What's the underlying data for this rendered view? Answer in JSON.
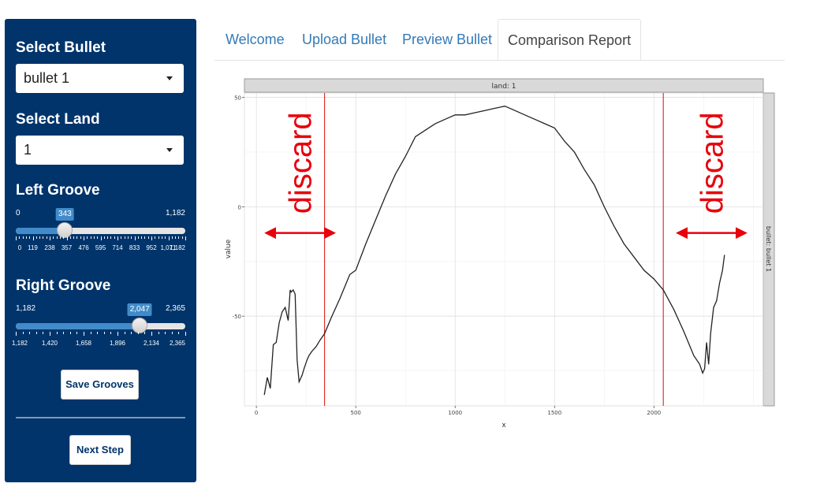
{
  "sidebar": {
    "select_bullet": {
      "label": "Select Bullet",
      "value": "bullet 1"
    },
    "select_land": {
      "label": "Select Land",
      "value": "1"
    },
    "left_groove": {
      "label": "Left Groove",
      "min_label": "0",
      "max_label": "1,182",
      "value_label": "343",
      "min": 0,
      "max": 1182,
      "value": 343,
      "ticks": [
        "0",
        "119",
        "238",
        "357",
        "476",
        "595",
        "714",
        "833",
        "952",
        "1,071",
        "1,182"
      ]
    },
    "right_groove": {
      "label": "Right Groove",
      "min_label": "1,182",
      "max_label": "2,365",
      "value_label": "2,047",
      "min": 1182,
      "max": 2365,
      "value": 2047,
      "ticks": [
        "1,182",
        "1,420",
        "1,658",
        "1,896",
        "2,134",
        "2,365"
      ]
    },
    "save_button": "Save Grooves",
    "next_button": "Next Step"
  },
  "tabs": [
    {
      "label": "Welcome",
      "active": false
    },
    {
      "label": "Upload Bullet",
      "active": false
    },
    {
      "label": "Preview Bullet",
      "active": false
    },
    {
      "label": "Comparison Report",
      "active": true
    }
  ],
  "chart_data": {
    "type": "line",
    "facet_top": "land: 1",
    "facet_right": "bullet: bullet 1",
    "xlabel": "x",
    "ylabel": "value",
    "xlim": [
      -60,
      2550
    ],
    "ylim": [
      -91,
      52
    ],
    "xticks": [
      0,
      500,
      1000,
      1500,
      2000
    ],
    "yticks": [
      -50,
      0,
      50
    ],
    "grid": true,
    "vlines": [
      343,
      2047
    ],
    "vline_color": "#e0201c",
    "annotation_color": "#e8000b",
    "annotations": [
      {
        "text": "discard",
        "x": 220,
        "y": 5
      },
      {
        "text": "discard",
        "x": 2290,
        "y": 5
      }
    ],
    "series": [
      {
        "x": [
          40,
          55,
          70,
          85,
          100,
          115,
          130,
          145,
          160,
          170,
          175,
          185,
          195,
          205,
          215,
          220,
          230,
          240,
          255,
          265,
          280,
          300,
          320,
          343,
          380,
          420,
          470,
          500,
          550,
          600,
          650,
          700,
          750,
          800,
          850,
          900,
          950,
          1000,
          1050,
          1100,
          1150,
          1200,
          1250,
          1300,
          1350,
          1400,
          1450,
          1500,
          1550,
          1600,
          1650,
          1700,
          1750,
          1800,
          1850,
          1900,
          1950,
          2000,
          2047,
          2100,
          2150,
          2200,
          2230,
          2245,
          2255,
          2265,
          2275,
          2285,
          2300,
          2315,
          2330,
          2345,
          2355
        ],
        "y": [
          -86,
          -78,
          -83,
          -63,
          -62,
          -53,
          -48,
          -46,
          -52,
          -38,
          -39,
          -38,
          -40,
          -70,
          -80,
          -79,
          -77,
          -74,
          -70,
          -68,
          -66,
          -64,
          -61,
          -58,
          -50,
          -42,
          -31,
          -29,
          -17,
          -6,
          5,
          15,
          23,
          32,
          35,
          38,
          40,
          42,
          42,
          43,
          44,
          45,
          46,
          44,
          42,
          40,
          38,
          36,
          30,
          25,
          17,
          10,
          0,
          -9,
          -17,
          -23,
          -29,
          -33,
          -38,
          -47,
          -57,
          -68,
          -72,
          -76,
          -74,
          -62,
          -72,
          -58,
          -46,
          -43,
          -35,
          -29,
          -22
        ]
      }
    ]
  }
}
